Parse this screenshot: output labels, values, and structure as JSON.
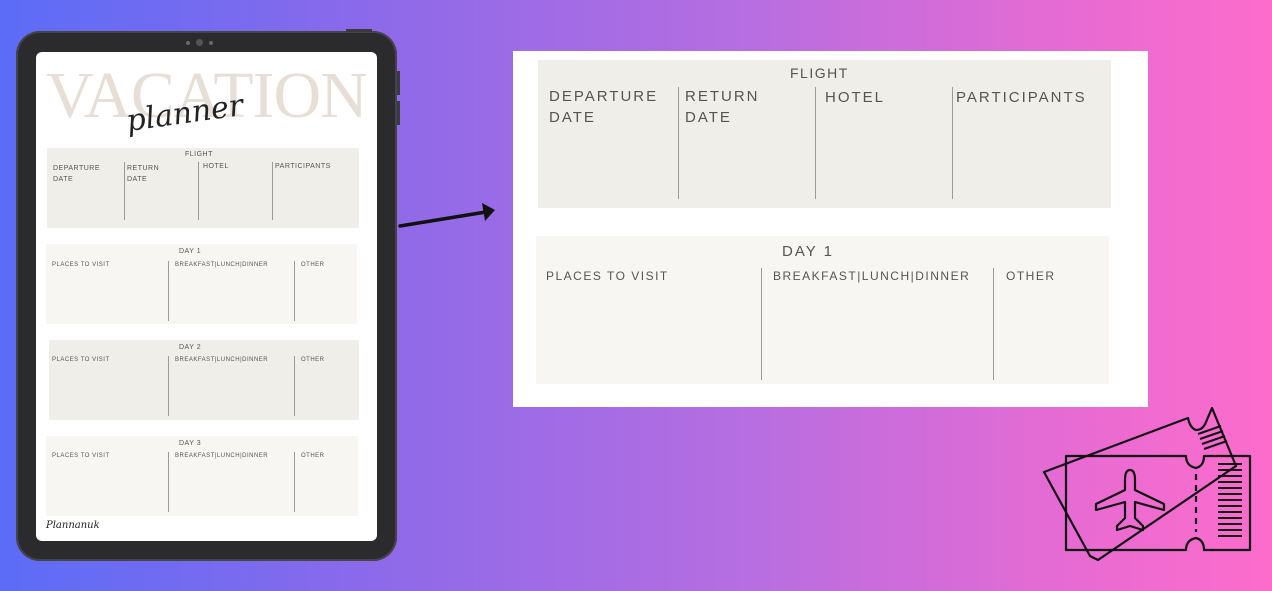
{
  "planner": {
    "title": "VACATION",
    "subtitle": "planner",
    "brand": "Plannanuk",
    "flight": {
      "header": "FLIGHT",
      "columns": [
        "DEPARTURE DATE",
        "RETURN DATE",
        "HOTEL",
        "PARTICIPANTS"
      ]
    },
    "days": [
      {
        "header": "DAY 1",
        "columns": [
          "PLACES TO VISIT",
          "BREAKFAST|LUNCH|DINNER",
          "OTHER"
        ]
      },
      {
        "header": "DAY 2",
        "columns": [
          "PLACES TO VISIT",
          "BREAKFAST|LUNCH|DINNER",
          "OTHER"
        ]
      },
      {
        "header": "DAY 3",
        "columns": [
          "PLACES TO VISIT",
          "BREAKFAST|LUNCH|DINNER",
          "OTHER"
        ]
      }
    ]
  },
  "zoom": {
    "flight": {
      "header": "FLIGHT",
      "departure_line1": "DEPARTURE",
      "departure_line2": "DATE",
      "return_line1": "RETURN",
      "return_line2": "DATE",
      "hotel": "HOTEL",
      "participants": "PARTICIPANTS"
    },
    "day": {
      "header": "DAY 1",
      "places": "PLACES TO VISIT",
      "meals": "BREAKFAST|LUNCH|DINNER",
      "other": "OTHER"
    }
  },
  "icons": {
    "arrow": "arrow-right-icon",
    "tickets": "plane-ticket-icon"
  },
  "colors": {
    "bg_left": "#5b6cf7",
    "bg_right": "#fd6ccb",
    "card_gray": "#efeee9",
    "title_beige": "#e7dfd6"
  }
}
